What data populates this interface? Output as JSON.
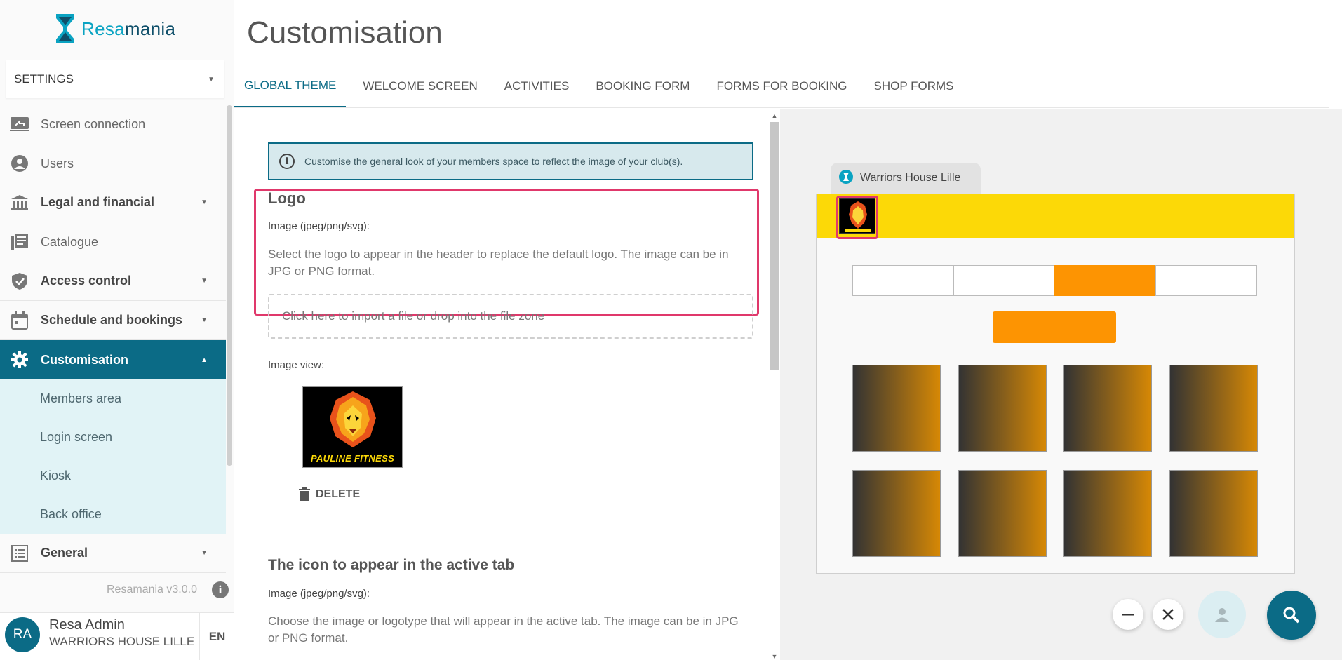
{
  "brand": {
    "word_part1": "Resa",
    "word_part2": "mania",
    "logo_icon": "hourglass-logo-icon"
  },
  "settings_dropdown": {
    "value": "SETTINGS"
  },
  "sidebar": {
    "items": [
      {
        "label": "Screen connection",
        "icon": "screen-share-icon"
      },
      {
        "label": "Users",
        "icon": "user-circle-icon"
      },
      {
        "label": "Legal and financial",
        "icon": "bank-icon"
      },
      {
        "label": "Catalogue",
        "icon": "catalogue-icon"
      },
      {
        "label": "Access control",
        "icon": "shield-check-icon"
      },
      {
        "label": "Schedule and bookings",
        "icon": "calendar-icon"
      },
      {
        "label": "Customisation",
        "icon": "gear-icon"
      },
      {
        "label": "General",
        "icon": "list-icon"
      }
    ],
    "subitems": [
      "Members area",
      "Login screen",
      "Kiosk",
      "Back office"
    ]
  },
  "version": "Resamania v3.0.0",
  "user": {
    "initials": "RA",
    "name": "Resa Admin",
    "club": "WARRIORS HOUSE LILLE",
    "lang": "EN"
  },
  "page": {
    "title": "Customisation"
  },
  "tabs": [
    "GLOBAL THEME",
    "WELCOME SCREEN",
    "ACTIVITIES",
    "BOOKING FORM",
    "FORMS FOR BOOKING",
    "SHOP FORMS"
  ],
  "info": {
    "text": "Customise the general look of your members space to reflect the image of your club(s)."
  },
  "logo_section": {
    "heading": "Logo",
    "image_label": "Image (jpeg/png/svg):",
    "description": "Select the logo to appear in the header to replace the default logo. The image can be in JPG or PNG format.",
    "dropzone": "Click here to import a file or drop into the file zone",
    "view_label": "Image view:",
    "logo_caption": "PAULINE FITNESS",
    "delete_label": "DELETE"
  },
  "icon_section": {
    "heading": "The icon to appear in the active tab",
    "image_label": "Image (jpeg/png/svg):",
    "description": "Choose the image or logotype that will appear in the active tab. The image can be in JPG or PNG format."
  },
  "preview": {
    "tab_title": "Warriors House Lille",
    "header_color": "#fcd907",
    "accent_color": "#fd9402"
  },
  "colors": {
    "primary": "#0b6b86",
    "highlight": "#e0386b",
    "brand_light": "#0aa3c2"
  }
}
